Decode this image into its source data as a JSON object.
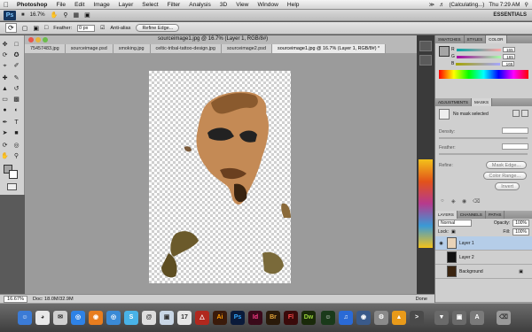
{
  "menubar": {
    "app": "Photoshop",
    "items": [
      "File",
      "Edit",
      "Image",
      "Layer",
      "Select",
      "Filter",
      "Analysis",
      "3D",
      "View",
      "Window",
      "Help"
    ],
    "status": "(Calculating...)",
    "clock": "Thu 7:29 AM"
  },
  "appbar": {
    "logo": "Ps",
    "zoom": "16.7%",
    "workspace": "ESSENTIALS"
  },
  "options": {
    "feather_label": "Feather:",
    "feather_value": "0 px",
    "antialias_label": "Anti-alias",
    "refine_label": "Refine Edge..."
  },
  "document": {
    "title": "sourceimage1.jpg @ 16.7% (Layer 1, RGB/8#)",
    "tabs": [
      "75457483.jpg",
      "sourceimage.psd",
      "smoking.jpg",
      "celtic-tribal-tattoo-design.jpg",
      "sourceimage2.psd",
      "sourceimage1.jpg @ 16.7% (Layer 1, RGB/8#) *"
    ]
  },
  "status": {
    "zoom": "16.67%",
    "doc": "Doc: 18.0M/32.9M",
    "done": "Done"
  },
  "color_panel": {
    "tabs": [
      "SWATCHES",
      "STYLES",
      "COLOR"
    ],
    "r_label": "R",
    "g_label": "G",
    "b_label": "B",
    "r": "165",
    "g": "165",
    "b": "165"
  },
  "masks_panel": {
    "tabs": [
      "MASKS",
      "ADJUSTMENTS"
    ],
    "status": "No mask selected",
    "density": "Density:",
    "feather": "Feather:",
    "refine": "Refine:",
    "mask_edge": "Mask Edge...",
    "color_range": "Color Range...",
    "invert": "Invert"
  },
  "layers_panel": {
    "tabs": [
      "LAYERS",
      "CHANNELS",
      "PATHS"
    ],
    "blend": "Normal",
    "opacity_label": "Opacity:",
    "opacity": "100%",
    "lock_label": "Lock:",
    "fill_label": "Fill:",
    "fill": "100%",
    "layers": [
      "Layer 1",
      "Layer 2",
      "Background"
    ]
  },
  "dock": {
    "apps": [
      "Ai",
      "Ps",
      "Id",
      "Br",
      "Fl",
      "Dw"
    ]
  },
  "colors": {
    "accent": "#b5cde8",
    "menubar": "#e0e0e0"
  }
}
